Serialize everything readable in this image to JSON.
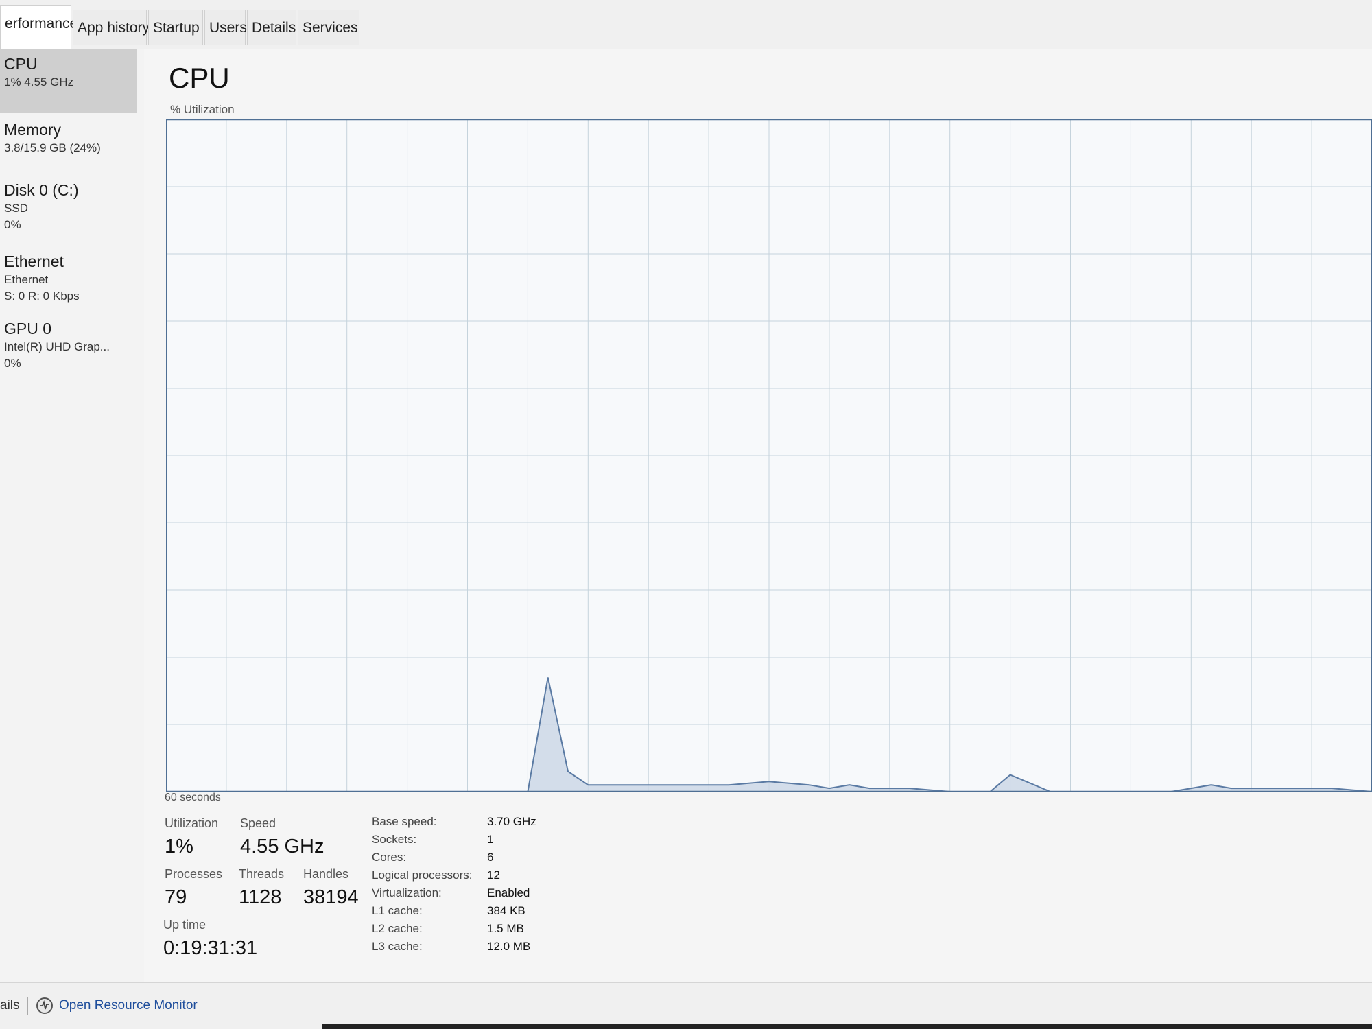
{
  "tabs": [
    {
      "label": "erformance",
      "active": true
    },
    {
      "label": "App history",
      "active": false
    },
    {
      "label": "Startup",
      "active": false
    },
    {
      "label": "Users",
      "active": false
    },
    {
      "label": "Details",
      "active": false
    },
    {
      "label": "Services",
      "active": false
    }
  ],
  "sidebar": {
    "items": [
      {
        "title": "CPU",
        "lines": [
          "1% 4.55 GHz"
        ],
        "selected": true
      },
      {
        "title": "Memory",
        "lines": [
          "3.8/15.9 GB (24%)"
        ],
        "selected": false
      },
      {
        "title": "Disk 0 (C:)",
        "lines": [
          "SSD",
          "0%"
        ],
        "selected": false
      },
      {
        "title": "Ethernet",
        "lines": [
          "Ethernet",
          "S: 0 R: 0 Kbps"
        ],
        "selected": false
      },
      {
        "title": "GPU 0",
        "lines": [
          "Intel(R) UHD Grap...",
          "0%"
        ],
        "selected": false
      }
    ]
  },
  "main": {
    "title": "CPU",
    "chart_label": "% Utilization",
    "axis_time_label": "60 seconds"
  },
  "chart_data": {
    "type": "area",
    "ylabel": "% Utilization",
    "xlabel": "60 seconds",
    "xlim": [
      60,
      0
    ],
    "ylim": [
      0,
      100
    ],
    "grid": true,
    "series": [
      {
        "x": [
          60,
          55,
          50,
          45,
          42,
          41,
          40,
          39,
          38,
          37,
          35,
          32,
          30,
          28,
          27,
          26,
          25,
          24,
          23,
          21,
          20,
          19,
          18,
          16,
          15,
          14,
          12,
          10,
          9,
          8,
          7,
          6,
          4,
          2,
          0
        ],
        "values": [
          0,
          0,
          0,
          0,
          0,
          17,
          3,
          1,
          1,
          1,
          1,
          1,
          1.5,
          1,
          0.5,
          1,
          0.5,
          0.5,
          0.5,
          0,
          0,
          0,
          2.5,
          0,
          0,
          0,
          0,
          0,
          0.5,
          1,
          0.5,
          0.5,
          0.5,
          0.5,
          0
        ]
      }
    ],
    "colors": {
      "line": "#5a7aa3",
      "fill": "#c9d6e6",
      "grid": "#c5d3dc",
      "border": "#4f6f94"
    }
  },
  "stats": {
    "utilization": {
      "label": "Utilization",
      "value": "1%"
    },
    "speed": {
      "label": "Speed",
      "value": "4.55 GHz"
    },
    "processes": {
      "label": "Processes",
      "value": "79"
    },
    "threads": {
      "label": "Threads",
      "value": "1128"
    },
    "handles": {
      "label": "Handles",
      "value": "38194"
    },
    "uptime": {
      "label": "Up time",
      "value": "0:19:31:31"
    }
  },
  "specs": [
    {
      "label": "Base speed:",
      "value": "3.70 GHz"
    },
    {
      "label": "Sockets:",
      "value": "1"
    },
    {
      "label": "Cores:",
      "value": "6"
    },
    {
      "label": "Logical processors:",
      "value": "12"
    },
    {
      "label": "Virtualization:",
      "value": "Enabled"
    },
    {
      "label": "L1 cache:",
      "value": "384 KB"
    },
    {
      "label": "L2 cache:",
      "value": "1.5 MB"
    },
    {
      "label": "L3 cache:",
      "value": "12.0 MB"
    }
  ],
  "footer": {
    "fewer_details": "ails",
    "open_resource_monitor": "Open Resource Monitor",
    "monitor_icon": "resource-monitor-icon"
  }
}
